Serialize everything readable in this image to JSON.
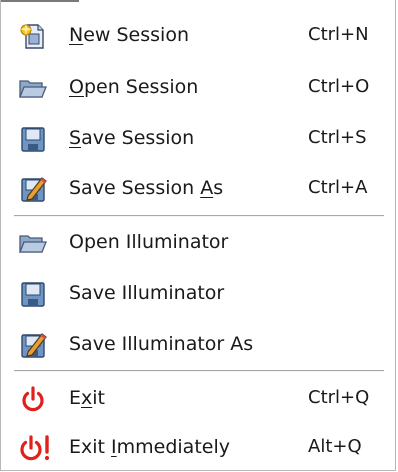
{
  "menu": {
    "items": [
      {
        "pre": "",
        "mn": "N",
        "post": "ew Session",
        "shortcut": "Ctrl+N",
        "icon": "new-session-icon"
      },
      {
        "pre": "",
        "mn": "O",
        "post": "pen Session",
        "shortcut": "Ctrl+O",
        "icon": "open-folder-icon"
      },
      {
        "pre": "",
        "mn": "S",
        "post": "ave Session",
        "shortcut": "Ctrl+S",
        "icon": "floppy-disk-icon"
      },
      {
        "pre": "Save Session ",
        "mn": "A",
        "post": "s",
        "shortcut": "Ctrl+A",
        "icon": "floppy-pencil-icon"
      },
      {
        "pre": "Open Illuminator",
        "mn": "",
        "post": "",
        "shortcut": "",
        "icon": "open-folder-icon"
      },
      {
        "pre": "Save Illuminator",
        "mn": "",
        "post": "",
        "shortcut": "",
        "icon": "floppy-disk-icon"
      },
      {
        "pre": "Save Illuminator As",
        "mn": "",
        "post": "",
        "shortcut": "",
        "icon": "floppy-pencil-icon"
      },
      {
        "pre": "E",
        "mn": "x",
        "post": "it",
        "shortcut": "Ctrl+Q",
        "icon": "power-icon"
      },
      {
        "pre": "Exit ",
        "mn": "I",
        "post": "mmediately",
        "shortcut": "Alt+Q",
        "icon": "power-exclamation-icon"
      }
    ]
  },
  "colors": {
    "exit_red": "#e0201a",
    "folder_blue": "#7f9bbf",
    "disk_blue": "#7aa0c8"
  }
}
